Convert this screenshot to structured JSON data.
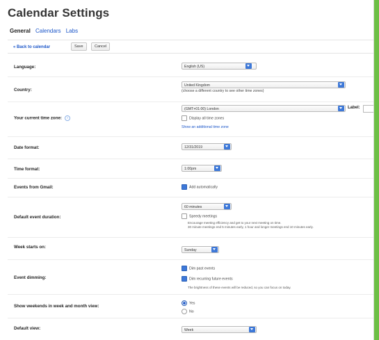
{
  "title": "Calendar Settings",
  "tabs": [
    {
      "label": "General",
      "active": true
    },
    {
      "label": "Calendars",
      "active": false
    },
    {
      "label": "Labs",
      "active": false
    }
  ],
  "actions": {
    "back": "« Back to calendar",
    "save": "Save",
    "cancel": "Cancel"
  },
  "settings": {
    "language": {
      "label": "Language:",
      "value": "English (US)"
    },
    "country": {
      "label": "Country:",
      "value": "United Kingdom",
      "hint": "(choose a different country to see other time zones)"
    },
    "timezone": {
      "label": "Your current time zone:",
      "value": "(GMT+01:00) London",
      "label_field": "Label:",
      "display_all": "Display all time zones",
      "additional": "Show an additional time zone"
    },
    "date_format": {
      "label": "Date format:",
      "value": "12/31/2019"
    },
    "time_format": {
      "label": "Time format:",
      "value": "1:00pm"
    },
    "events_gmail": {
      "label": "Events from Gmail:",
      "option": "Add automatically",
      "checked": true
    },
    "default_duration": {
      "label": "Default event duration:",
      "value": "60 minutes",
      "speedy": "Speedy meetings",
      "speedy_desc_1": "Encourage meeting efficiency and get to your next meeting on time.",
      "speedy_desc_2": "30 minute meetings end 5 minutes early, 1 hour and longer meetings end 10 minutes early."
    },
    "week_start": {
      "label": "Week starts on:",
      "value": "Sunday"
    },
    "event_dimming": {
      "label": "Event dimming:",
      "past": "Dim past events",
      "recurring": "Dim recurring future events",
      "note": "The brightness of these events will be reduced, so you can focus on today."
    },
    "weekends": {
      "label": "Show weekends in week and month view:",
      "yes": "Yes",
      "no": "No",
      "selected": "Yes"
    },
    "default_view": {
      "label": "Default view:",
      "value": "Week"
    }
  },
  "colors": {
    "accent": "#3d78d8",
    "link": "#1a55c8",
    "background_band": "#6dbf45"
  }
}
